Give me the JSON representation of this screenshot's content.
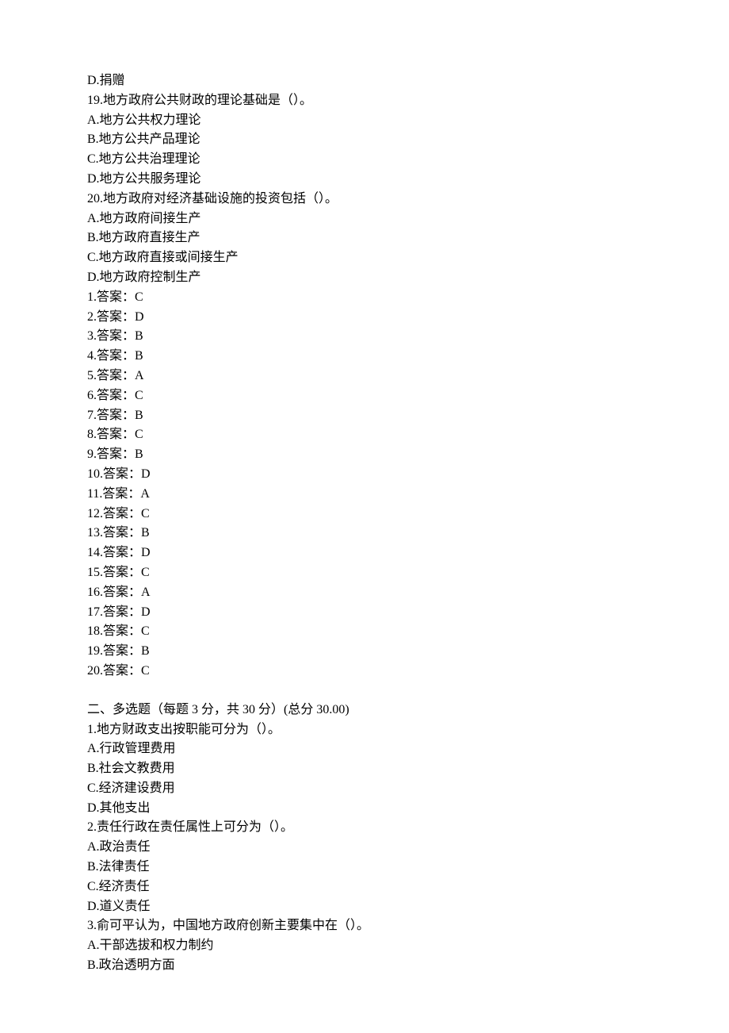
{
  "lines": {
    "l01": "D.捐赠",
    "l02": "19.地方政府公共财政的理论基础是（）。",
    "l03": "A.地方公共权力理论",
    "l04": "B.地方公共产品理论",
    "l05": "C.地方公共治理理论",
    "l06": "D.地方公共服务理论",
    "l07": "20.地方政府对经济基础设施的投资包括（）。",
    "l08": "A.地方政府间接生产",
    "l09": "B.地方政府直接生产",
    "l10": "C.地方政府直接或间接生产",
    "l11": "D.地方政府控制生产",
    "a01": "1.答案：C",
    "a02": "2.答案：D",
    "a03": "3.答案：B",
    "a04": "4.答案：B",
    "a05": "5.答案：A",
    "a06": "6.答案：C",
    "a07": "7.答案：B",
    "a08": "8.答案：C",
    "a09": "9.答案：B",
    "a10": "10.答案：D",
    "a11": "11.答案：A",
    "a12": "12.答案：C",
    "a13": "13.答案：B",
    "a14": "14.答案：D",
    "a15": "15.答案：C",
    "a16": "16.答案：A",
    "a17": "17.答案：D",
    "a18": "18.答案：C",
    "a19": "19.答案：B",
    "a20": "20.答案：C",
    "sec2": "二、多选题（每题 3 分，共 30 分）(总分 30.00)",
    "m01": "1.地方财政支出按职能可分为（）。",
    "m02": "A.行政管理费用",
    "m03": "B.社会文教费用",
    "m04": "C.经济建设费用",
    "m05": "D.其他支出",
    "m06": "2.责任行政在责任属性上可分为（）。",
    "m07": "A.政治责任",
    "m08": "B.法律责任",
    "m09": "C.经济责任",
    "m10": "D.道义责任",
    "m11": "3.俞可平认为，中国地方政府创新主要集中在（）。",
    "m12": "A.干部选拔和权力制约",
    "m13": "B.政治透明方面"
  }
}
